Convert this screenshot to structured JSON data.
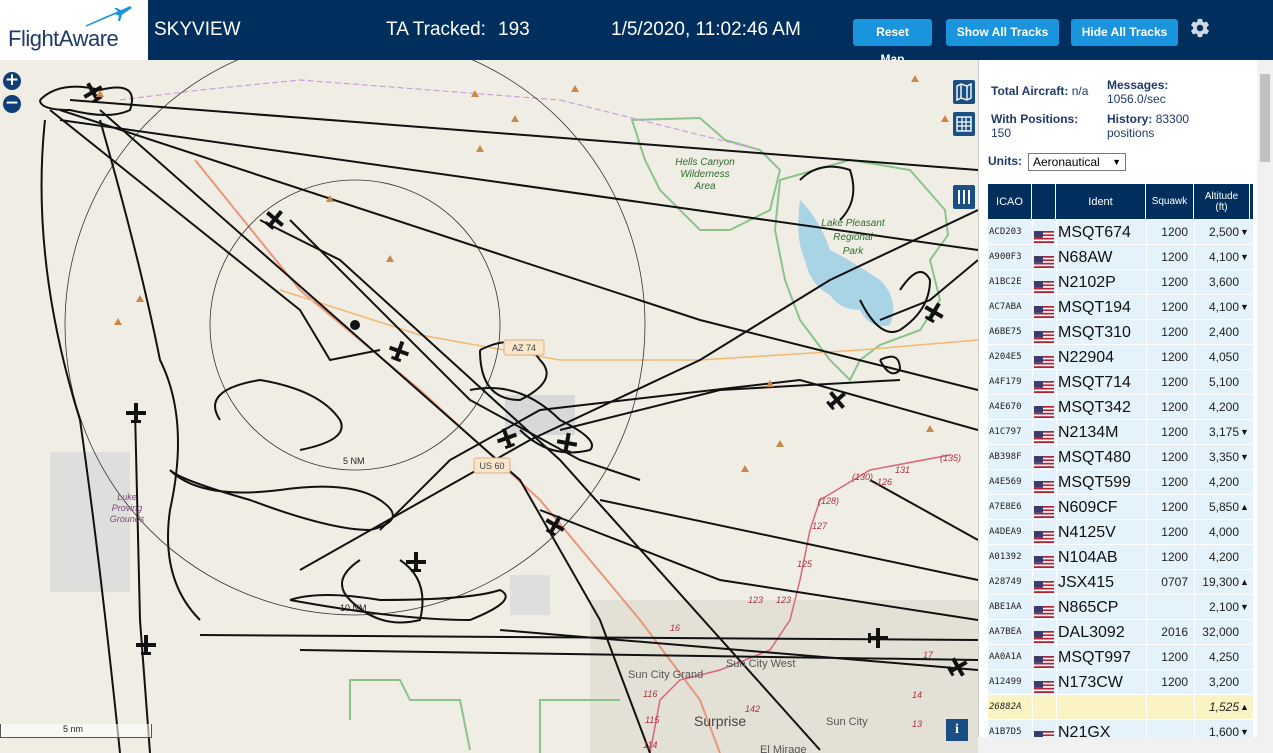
{
  "header": {
    "logo_text": "FlightAware",
    "app_title": "SKYVIEW",
    "ta_label": "TA Tracked:",
    "ta_count": "193",
    "datetime": "1/5/2020, 11:02:46 AM",
    "reset_label": "Reset Map",
    "show_label": "Show All Tracks",
    "hide_label": "Hide All Tracks"
  },
  "map": {
    "labels": {
      "hells_canyon": [
        "Hells Canyon",
        "Wilderness",
        "Area"
      ],
      "lake_pleasant": [
        "Lake Pleasant",
        "Regional",
        "Park"
      ],
      "luke": [
        "Luke",
        "Proving",
        "Grounds"
      ],
      "ring_5": "5 NM",
      "ring_10": "10 NM",
      "az74": "AZ 74",
      "us60": "US 60",
      "sun_city_west": "Sun City West",
      "sun_city_grand": "Sun City Grand",
      "surprise": "Surprise",
      "sun_city": "Sun City",
      "el_mirage": "El Mirage",
      "scale": "5 nm",
      "road_numbers": [
        "(128)",
        "127",
        "125",
        "123",
        "123",
        "(130)",
        "131",
        "(135)",
        "116",
        "115",
        "114",
        "142",
        "17",
        "16",
        "14",
        "13",
        "126"
      ]
    },
    "zoom_in": "+",
    "zoom_out": "−",
    "info": "i"
  },
  "panel": {
    "total_label": "Total Aircraft:",
    "total_value": "n/a",
    "messages_label": "Messages:",
    "messages_value": "1056.0/sec",
    "positions_label": "With Positions:",
    "positions_value": "150",
    "history_label": "History:",
    "history_value": "83300",
    "history_unit": "positions",
    "units_label": "Units:",
    "units_value": "Aeronautical",
    "columns": {
      "icao": "ICAO",
      "ident": "Ident",
      "squawk": "Squawk",
      "altitude": "Altitude\n(ft)"
    },
    "rows": [
      {
        "icao": "ACD203",
        "ident": "MSQT674",
        "squawk": "1200",
        "alt": "2,500",
        "trend": "▼"
      },
      {
        "icao": "A900F3",
        "ident": "N68AW",
        "squawk": "1200",
        "alt": "4,100",
        "trend": "▼"
      },
      {
        "icao": "A1BC2E",
        "ident": "N2102P",
        "squawk": "1200",
        "alt": "3,600",
        "trend": ""
      },
      {
        "icao": "AC7ABA",
        "ident": "MSQT194",
        "squawk": "1200",
        "alt": "4,100",
        "trend": "▼"
      },
      {
        "icao": "A6BE75",
        "ident": "MSQT310",
        "squawk": "1200",
        "alt": "2,400",
        "trend": ""
      },
      {
        "icao": "A204E5",
        "ident": "N22904",
        "squawk": "1200",
        "alt": "4,050",
        "trend": ""
      },
      {
        "icao": "A4F179",
        "ident": "MSQT714",
        "squawk": "1200",
        "alt": "5,100",
        "trend": ""
      },
      {
        "icao": "A4E670",
        "ident": "MSQT342",
        "squawk": "1200",
        "alt": "4,200",
        "trend": ""
      },
      {
        "icao": "A1C797",
        "ident": "N2134M",
        "squawk": "1200",
        "alt": "3,175",
        "trend": "▼"
      },
      {
        "icao": "AB398F",
        "ident": "MSQT480",
        "squawk": "1200",
        "alt": "3,350",
        "trend": "▼"
      },
      {
        "icao": "A4E569",
        "ident": "MSQT599",
        "squawk": "1200",
        "alt": "4,200",
        "trend": ""
      },
      {
        "icao": "A7E8E6",
        "ident": "N609CF",
        "squawk": "1200",
        "alt": "5,850",
        "trend": "▲"
      },
      {
        "icao": "A4DEA9",
        "ident": "N4125V",
        "squawk": "1200",
        "alt": "4,000",
        "trend": ""
      },
      {
        "icao": "A01392",
        "ident": "N104AB",
        "squawk": "1200",
        "alt": "4,200",
        "trend": ""
      },
      {
        "icao": "A28749",
        "ident": "JSX415",
        "squawk": "0707",
        "alt": "19,300",
        "trend": "▲"
      },
      {
        "icao": "ABE1AA",
        "ident": "N865CP",
        "squawk": "",
        "alt": "2,100",
        "trend": "▼"
      },
      {
        "icao": "AA7BEA",
        "ident": "DAL3092",
        "squawk": "2016",
        "alt": "32,000",
        "trend": ""
      },
      {
        "icao": "AA0A1A",
        "ident": "MSQT997",
        "squawk": "1200",
        "alt": "4,250",
        "trend": ""
      },
      {
        "icao": "A12499",
        "ident": "N173CW",
        "squawk": "1200",
        "alt": "3,200",
        "trend": ""
      },
      {
        "icao": "26882A",
        "ident": "",
        "squawk": "",
        "alt": "1,525",
        "trend": "▲",
        "highlight": true,
        "no_flag": true
      },
      {
        "icao": "A1B7D5",
        "ident": "N21GX",
        "squawk": "",
        "alt": "1,600",
        "trend": "▼"
      }
    ]
  },
  "colors": {
    "header_bg": "#002f5d",
    "button_bg": "#1a94dc",
    "row_bg": "#e3f2fb",
    "row_highlight": "#fcf3c4",
    "track": "#111111",
    "lake": "#a8d4e6",
    "wilderness_border": "#8bc48b",
    "road": "#e9967a"
  }
}
